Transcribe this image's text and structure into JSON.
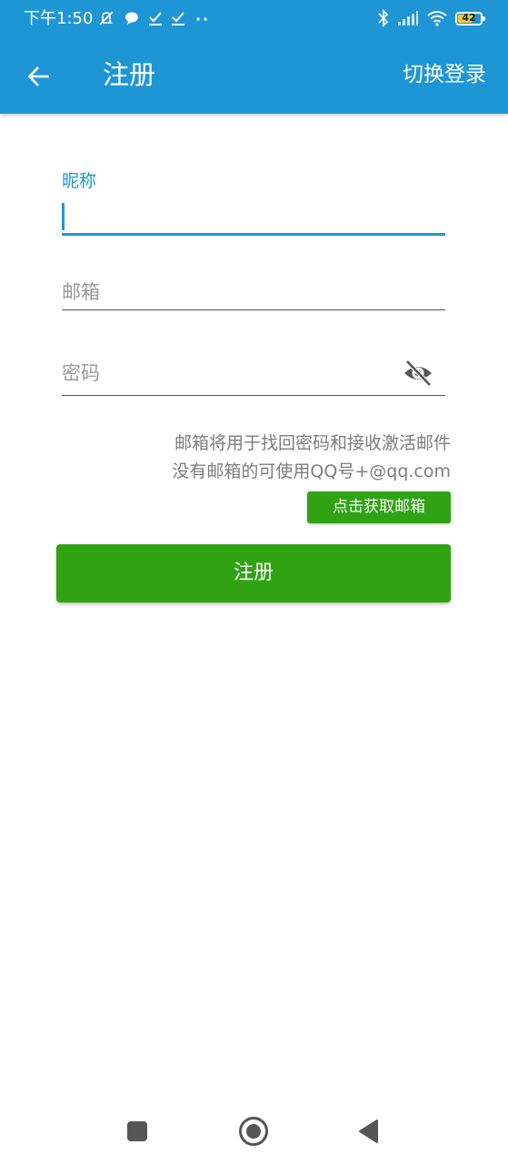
{
  "status_bar": {
    "time": "下午1:50",
    "battery_level": "42",
    "icons": [
      "mute-icon",
      "message-icon",
      "check-icon",
      "check-icon",
      "more-dots-icon",
      "bluetooth-icon",
      "signal-icon",
      "wifi-icon",
      "battery-icon"
    ]
  },
  "toolbar": {
    "back_icon": "arrow-left-icon",
    "title": "注册",
    "switch_login": "切换登录",
    "background_color": "#1e96d6"
  },
  "form": {
    "nickname": {
      "label": "昵称",
      "value": "",
      "focused": true
    },
    "email": {
      "placeholder": "邮箱",
      "value": ""
    },
    "password": {
      "placeholder": "密码",
      "value": "",
      "visibility_icon": "eye-off-icon"
    }
  },
  "hint": {
    "line1": "邮箱将用于找回密码和接收激活邮件",
    "line2": "没有邮箱的可使用QQ号+@qq.com"
  },
  "buttons": {
    "get_email": "点击获取邮箱",
    "register": "注册",
    "button_color": "#2fa314"
  },
  "nav_bar": {
    "icons": [
      "recents-square-icon",
      "home-circle-icon",
      "back-triangle-icon"
    ]
  }
}
